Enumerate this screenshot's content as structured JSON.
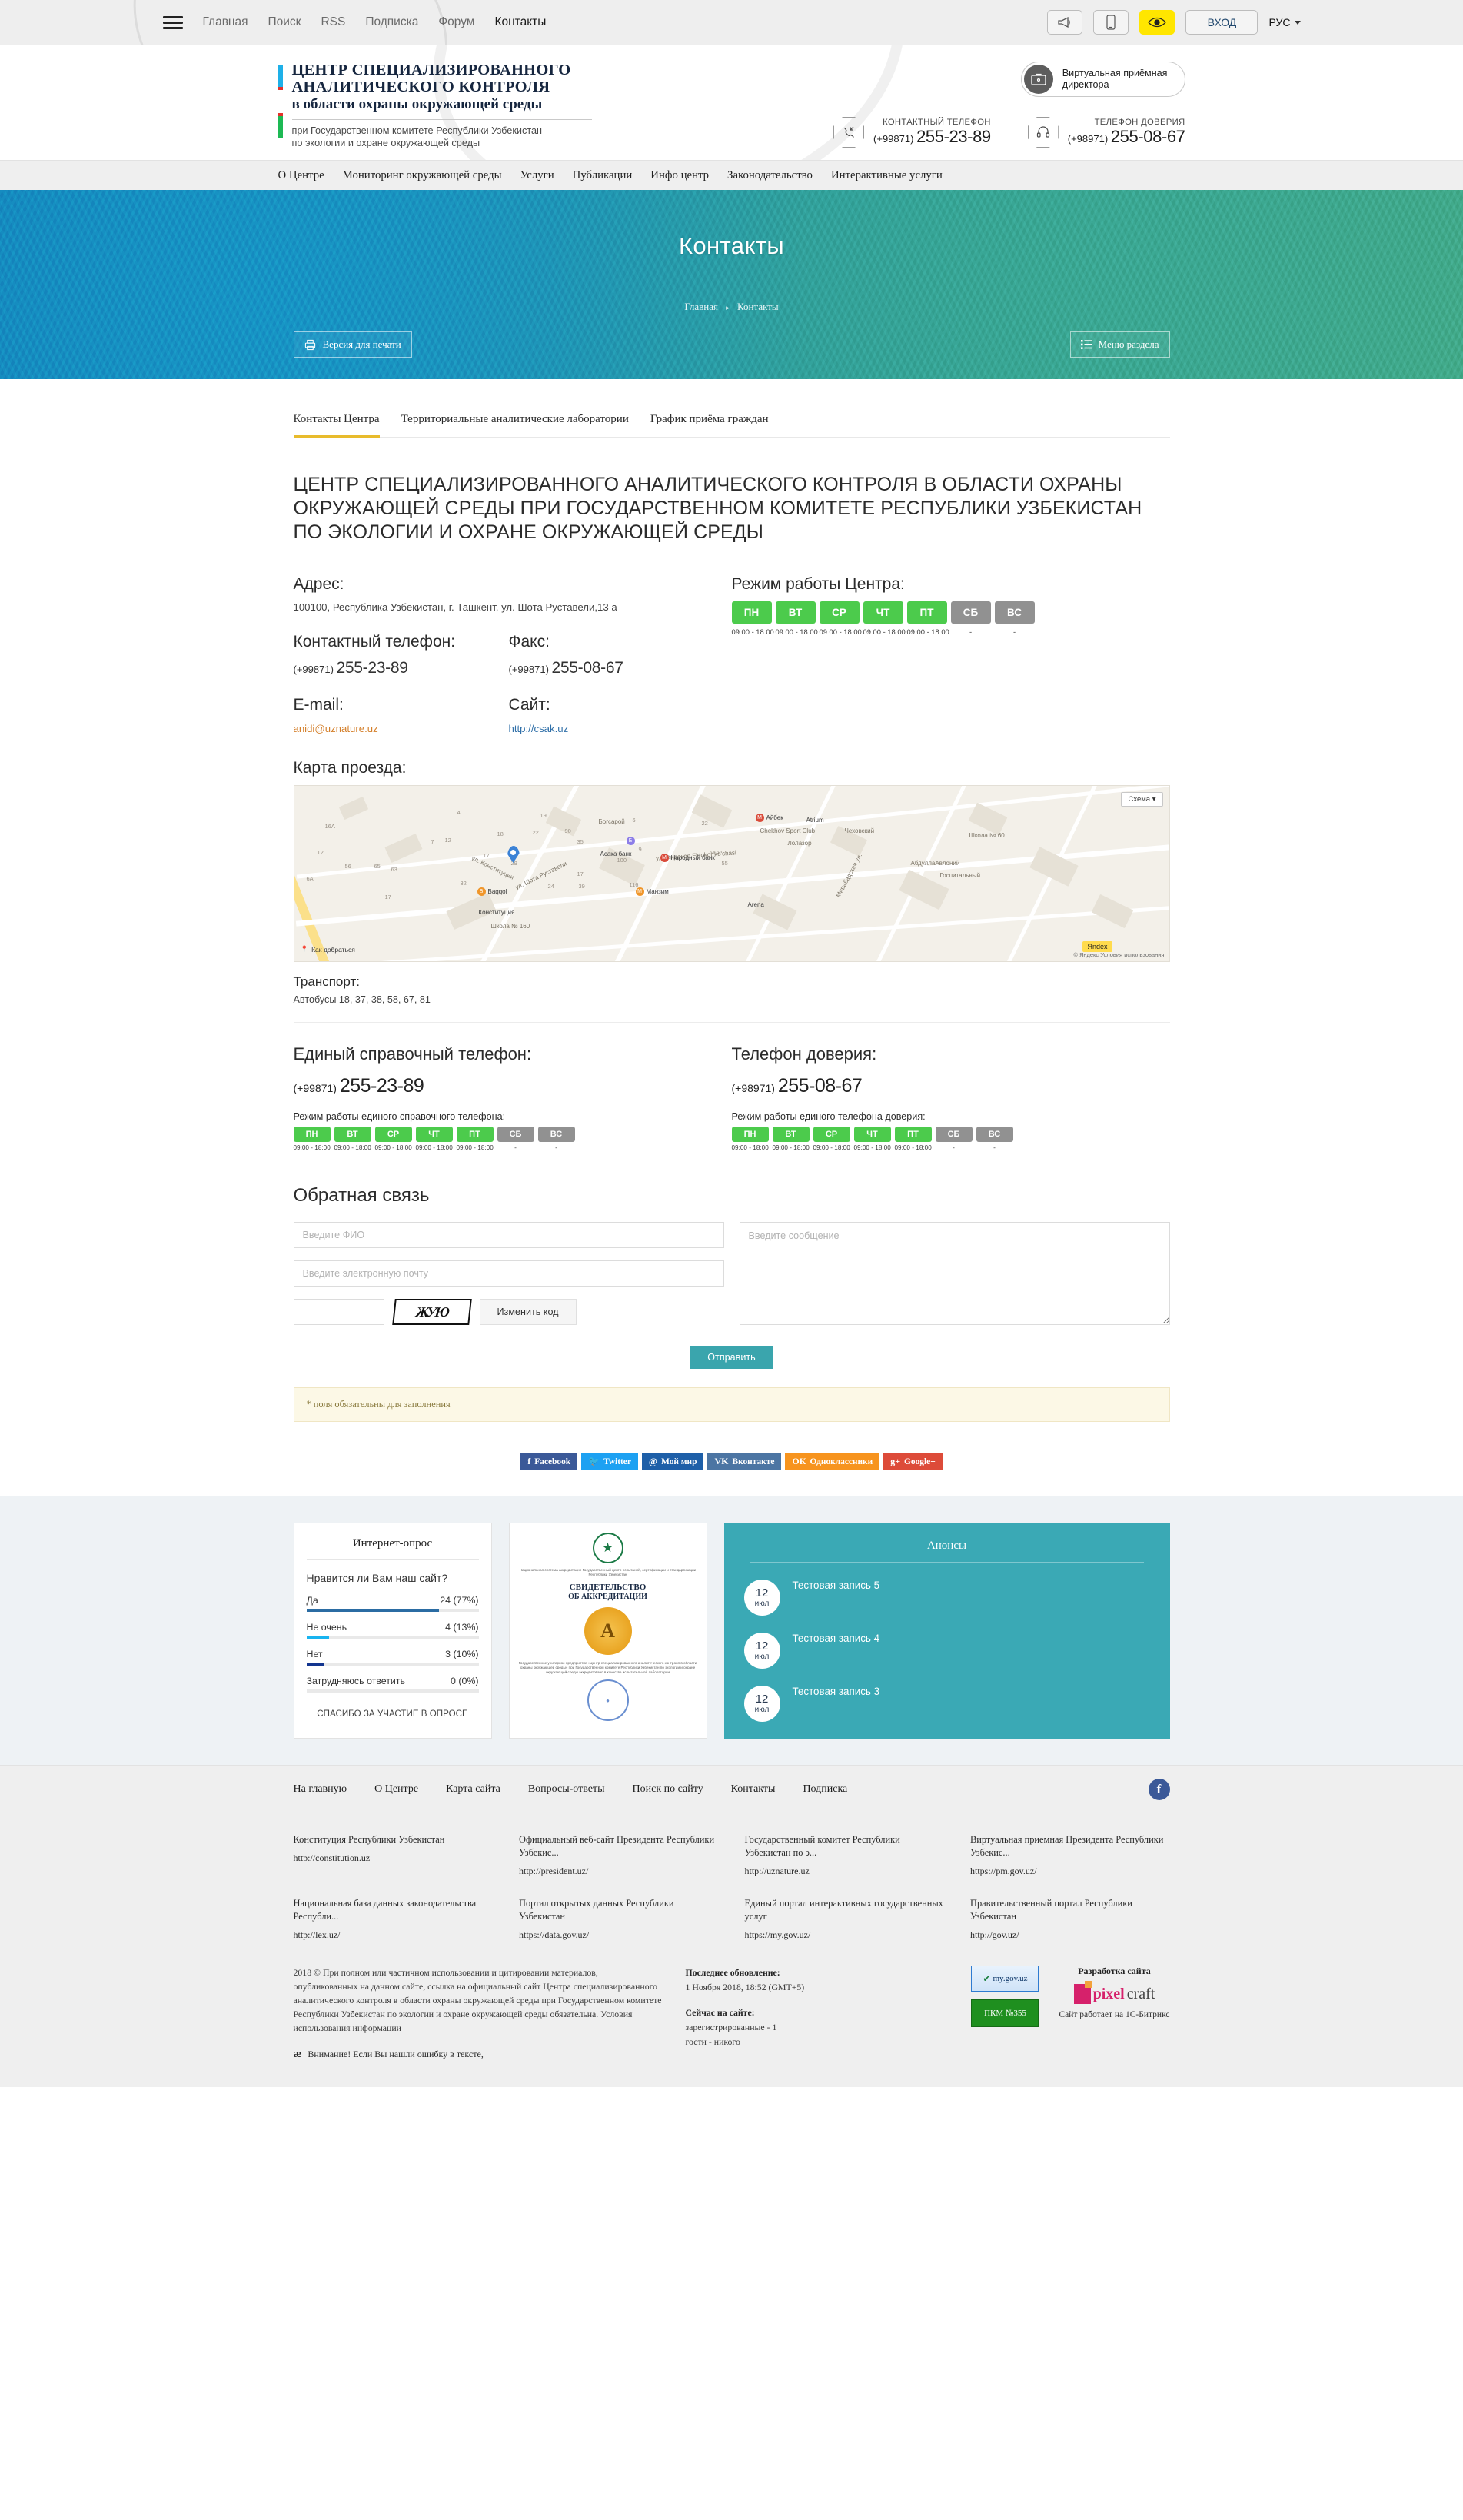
{
  "topbar": {
    "menu_icon": "hamburger-icon",
    "nav": [
      {
        "label": "Главная",
        "active": false
      },
      {
        "label": "Поиск",
        "active": false
      },
      {
        "label": "RSS",
        "active": false
      },
      {
        "label": "Подписка",
        "active": false
      },
      {
        "label": "Форум",
        "active": false
      },
      {
        "label": "Контакты",
        "active": true
      }
    ],
    "buttons": [
      {
        "icon": "megaphone-icon",
        "highlight": false
      },
      {
        "icon": "mobile-phone-icon",
        "highlight": false
      },
      {
        "icon": "eye-icon",
        "highlight": true
      }
    ],
    "login_label": "ВХОД",
    "lang_label": "РУС",
    "accent_yellow": "#ffe600"
  },
  "header": {
    "logo_line1": "ЦЕНТР СПЕЦИАЛИЗИРОВАННОГО",
    "logo_line2": "АНАЛИТИЧЕСКОГО КОНТРОЛЯ",
    "logo_line3": "в области охраны окружающей среды",
    "logo_sub1": "при Государственном комитете Республики Узбекистан",
    "logo_sub2": "по экологии и охране окружающей среды",
    "virtual_reception_line1": "Виртуальная приёмная",
    "virtual_reception_line2": "директора",
    "phone1_label": "КОНТАКТНЫЙ ТЕЛЕФОН",
    "phone1_code": "(+99871)",
    "phone1_number": "255-23-89",
    "phone2_label": "ТЕЛЕФОН ДОВЕРИЯ",
    "phone2_code": "(+98971)",
    "phone2_number": "255-08-67"
  },
  "mainnav": [
    "О Центре",
    "Мониторинг окружающей среды",
    "Услуги",
    "Публикации",
    "Инфо центр",
    "Законодательство",
    "Интерактивные услуги"
  ],
  "hero": {
    "title": "Контакты",
    "breadcrumb_home": "Главная",
    "breadcrumb_current": "Контакты",
    "print_label": "Версия для печати",
    "section_menu_label": "Меню раздела"
  },
  "tabs": [
    {
      "label": "Контакты Центра",
      "active": true
    },
    {
      "label": "Территориальные аналитические лаборатории",
      "active": false
    },
    {
      "label": "График приёма граждан",
      "active": false
    }
  ],
  "page_title": "ЦЕНТР СПЕЦИАЛИЗИРОВАННОГО АНАЛИТИЧЕСКОГО КОНТРОЛЯ В ОБЛАСТИ ОХРАНЫ ОКРУЖАЮЩЕЙ СРЕДЫ ПРИ ГОСУДАРСТВЕННОМ КОМИТЕТЕ РЕСПУБЛИКИ УЗБЕКИСТАН ПО ЭКОЛОГИИ И ОХРАНЕ ОКРУЖАЮЩЕЙ СРЕДЫ",
  "contacts": {
    "address_label": "Адрес:",
    "address_value": "100100, Республика Узбекистан, г. Ташкент, ул. Шота Руставели,13 а",
    "phone_label": "Контактный телефон:",
    "phone_code": "(+99871)",
    "phone_number": "255-23-89",
    "fax_label": "Факс:",
    "fax_code": "(+99871)",
    "fax_number": "255-08-67",
    "email_label": "E-mail:",
    "email_value": "anidi@uznature.uz",
    "site_label": "Сайт:",
    "site_value": "http://csak.uz",
    "map_label": "Карта проезда:",
    "transport_label": "Транспорт:",
    "transport_value": "Автобусы 18, 37, 38, 58, 67, 81"
  },
  "schedule_center": {
    "title": "Режим работы Центра:",
    "days": [
      {
        "day": "ПН",
        "hours": "09:00 - 18:00",
        "open": true
      },
      {
        "day": "ВТ",
        "hours": "09:00 - 18:00",
        "open": true
      },
      {
        "day": "СР",
        "hours": "09:00 - 18:00",
        "open": true
      },
      {
        "day": "ЧТ",
        "hours": "09:00 - 18:00",
        "open": true
      },
      {
        "day": "ПТ",
        "hours": "09:00 - 18:00",
        "open": true
      },
      {
        "day": "СБ",
        "hours": "-",
        "open": false
      },
      {
        "day": "ВС",
        "hours": "-",
        "open": false
      }
    ]
  },
  "hotline": {
    "title": "Единый справочный телефон:",
    "code": "(+99871)",
    "number": "255-23-89",
    "schedule_label": "Режим работы единого справочного телефона:",
    "days": [
      {
        "day": "ПН",
        "hours": "09:00 - 18:00",
        "open": true
      },
      {
        "day": "ВТ",
        "hours": "09:00 - 18:00",
        "open": true
      },
      {
        "day": "СР",
        "hours": "09:00 - 18:00",
        "open": true
      },
      {
        "day": "ЧТ",
        "hours": "09:00 - 18:00",
        "open": true
      },
      {
        "day": "ПТ",
        "hours": "09:00 - 18:00",
        "open": true
      },
      {
        "day": "СБ",
        "hours": "-",
        "open": false
      },
      {
        "day": "ВС",
        "hours": "-",
        "open": false
      }
    ]
  },
  "trustline": {
    "title": "Телефон доверия:",
    "code": "(+98971)",
    "number": "255-08-67",
    "schedule_label": "Режим работы единого телефона доверия:",
    "days": [
      {
        "day": "ПН",
        "hours": "09:00 - 18:00",
        "open": true
      },
      {
        "day": "ВТ",
        "hours": "09:00 - 18:00",
        "open": true
      },
      {
        "day": "СР",
        "hours": "09:00 - 18:00",
        "open": true
      },
      {
        "day": "ЧТ",
        "hours": "09:00 - 18:00",
        "open": true
      },
      {
        "day": "ПТ",
        "hours": "09:00 - 18:00",
        "open": true
      },
      {
        "day": "СБ",
        "hours": "-",
        "open": false
      },
      {
        "day": "ВС",
        "hours": "-",
        "open": false
      }
    ]
  },
  "feedback": {
    "title": "Обратная связь",
    "name_placeholder": "Введите ФИО",
    "email_placeholder": "Введите электронную почту",
    "message_placeholder": "Введите сообщение",
    "captcha_value": "",
    "captcha_text": "ЖУЮ",
    "refresh_label": "Изменить код",
    "submit_label": "Отправить",
    "required_note": "* поля обязательны для заполнения"
  },
  "socials": [
    {
      "label": "Facebook",
      "glyph": "f",
      "color": "#3b5998"
    },
    {
      "label": "Twitter",
      "glyph": "🐦",
      "color": "#1da1f2"
    },
    {
      "label": "Мой мир",
      "glyph": "@",
      "color": "#1e5fa8"
    },
    {
      "label": "Вконтакте",
      "glyph": "VK",
      "color": "#4c75a3"
    },
    {
      "label": "Одноклассники",
      "glyph": "ОК",
      "color": "#f7941e"
    },
    {
      "label": "Google+",
      "glyph": "g+",
      "color": "#dd4b39"
    }
  ],
  "map": {
    "control_label": "Схема",
    "route_label": "Как добраться",
    "brand": "Яндекс",
    "attribution": "© Яндекс   Условия использования",
    "labels": [
      "Богсарой",
      "Асака банк",
      "Айбек",
      "Atrium",
      "Chekhov Sport Club",
      "Лолазор",
      "Народный банк",
      "Манзим",
      "Arena",
      "Школа № 60",
      "АбдуллаАвлоний",
      "Госпитальный",
      "Школа № 160",
      "Конституция",
      "ул. Шота Руставели",
      "ул. Фидокор Fidokor ko'chasi",
      "ул. Мирабадская",
      "ул. Конституции",
      "Baqqol"
    ]
  },
  "poll": {
    "title": "Интернет-опрос",
    "question": "Нравится ли Вам наш сайт?",
    "thanks": "СПАСИБО ЗА УЧАСТИЕ В ОПРОСЕ"
  },
  "announcements": {
    "title": "Анонсы",
    "items": [
      {
        "day": "12",
        "month": "июл",
        "text": "Тестовая запись 5"
      },
      {
        "day": "12",
        "month": "июл",
        "text": "Тестовая запись 4"
      },
      {
        "day": "12",
        "month": "июл",
        "text": "Тестовая запись 3"
      }
    ]
  },
  "certificate": {
    "org": "Национальная система аккредитации\nГосударственный центр испытаний, сертификации\nи стандартизации Республики Узбекистан",
    "title1": "СВИДЕТЕЛЬСТВО",
    "title2": "ОБ АККРЕДИТАЦИИ",
    "body": "Государственное унитарное предприятие «Центр специализированного аналитического контроля в области охраны окружающей среды» при Государственном комитете Республики Узбекистан по экологии и охране окружающей среды аккредитовано в качестве испытательной лаборатории"
  },
  "footer": {
    "nav": [
      "На главную",
      "О Центре",
      "Карта сайта",
      "Вопросы-ответы",
      "Поиск по сайту",
      "Контакты",
      "Подписка"
    ],
    "links": [
      {
        "title": "Конституция Республики Узбекистан",
        "url": "http://constitution.uz"
      },
      {
        "title": "Официальный веб-сайт Президента Республики Узбекис...",
        "url": "http://president.uz/"
      },
      {
        "title": "Государственный комитет Республики Узбекистан по э...",
        "url": "http://uznature.uz"
      },
      {
        "title": "Виртуальная приемная Президента Республики Узбекис...",
        "url": "https://pm.gov.uz/"
      },
      {
        "title": "Национальная база данных законодательства Республи...",
        "url": "http://lex.uz/"
      },
      {
        "title": "Портал открытых данных Республики Узбекистан",
        "url": "https://data.gov.uz/"
      },
      {
        "title": "Единый портал интерактивных государственных услуг",
        "url": "https://my.gov.uz/"
      },
      {
        "title": "Правительственный портал Республики Узбекистан",
        "url": "http://gov.uz/"
      }
    ],
    "copyright": "2018 © При полном или частичном использовании и цитировании материалов, опубликованных на данном сайте, ссылка на официальный сайт Центра специализированного аналитического контроля в области охраны окружающей среды при Государственном комитете Республики Узбекистан по экологии и охране окружающей среды обязательна. Условия использования информации",
    "warning": "Внимание! Если Вы нашли ошибку в тексте,",
    "updated_label": "Последнее обновление:",
    "updated_value": "1 Ноября 2018, 18:52 (GMT+5)",
    "online_label": "Сейчас на сайте:",
    "online_registered": "зарегистрированные - 1",
    "online_guests": "гости - никого",
    "badge_my": "my.gov.uz",
    "badge_pkm": "ПКМ №355",
    "dev_label": "Разработка сайта",
    "dev_name1": "pixel",
    "dev_name2": "craft",
    "engine": "Сайт работает на 1С-Битрикс"
  },
  "chart_data": {
    "type": "bar",
    "title": "Нравится ли Вам наш сайт?",
    "orientation": "horizontal",
    "categories": [
      "Да",
      "Не очень",
      "Нет",
      "Затрудняюсь ответить"
    ],
    "values": [
      24,
      4,
      3,
      0
    ],
    "percents": [
      77,
      13,
      10,
      0
    ],
    "labels": [
      "24 (77%)",
      "4 (13%)",
      "3 (10%)",
      "0 (0%)"
    ],
    "colors": [
      "#2b6ca3",
      "#18b4f0",
      "#13358f",
      "#e9e9e9"
    ],
    "xlabel": "",
    "ylabel": "",
    "xlim": [
      0,
      100
    ],
    "grid": false,
    "legend": "none"
  }
}
